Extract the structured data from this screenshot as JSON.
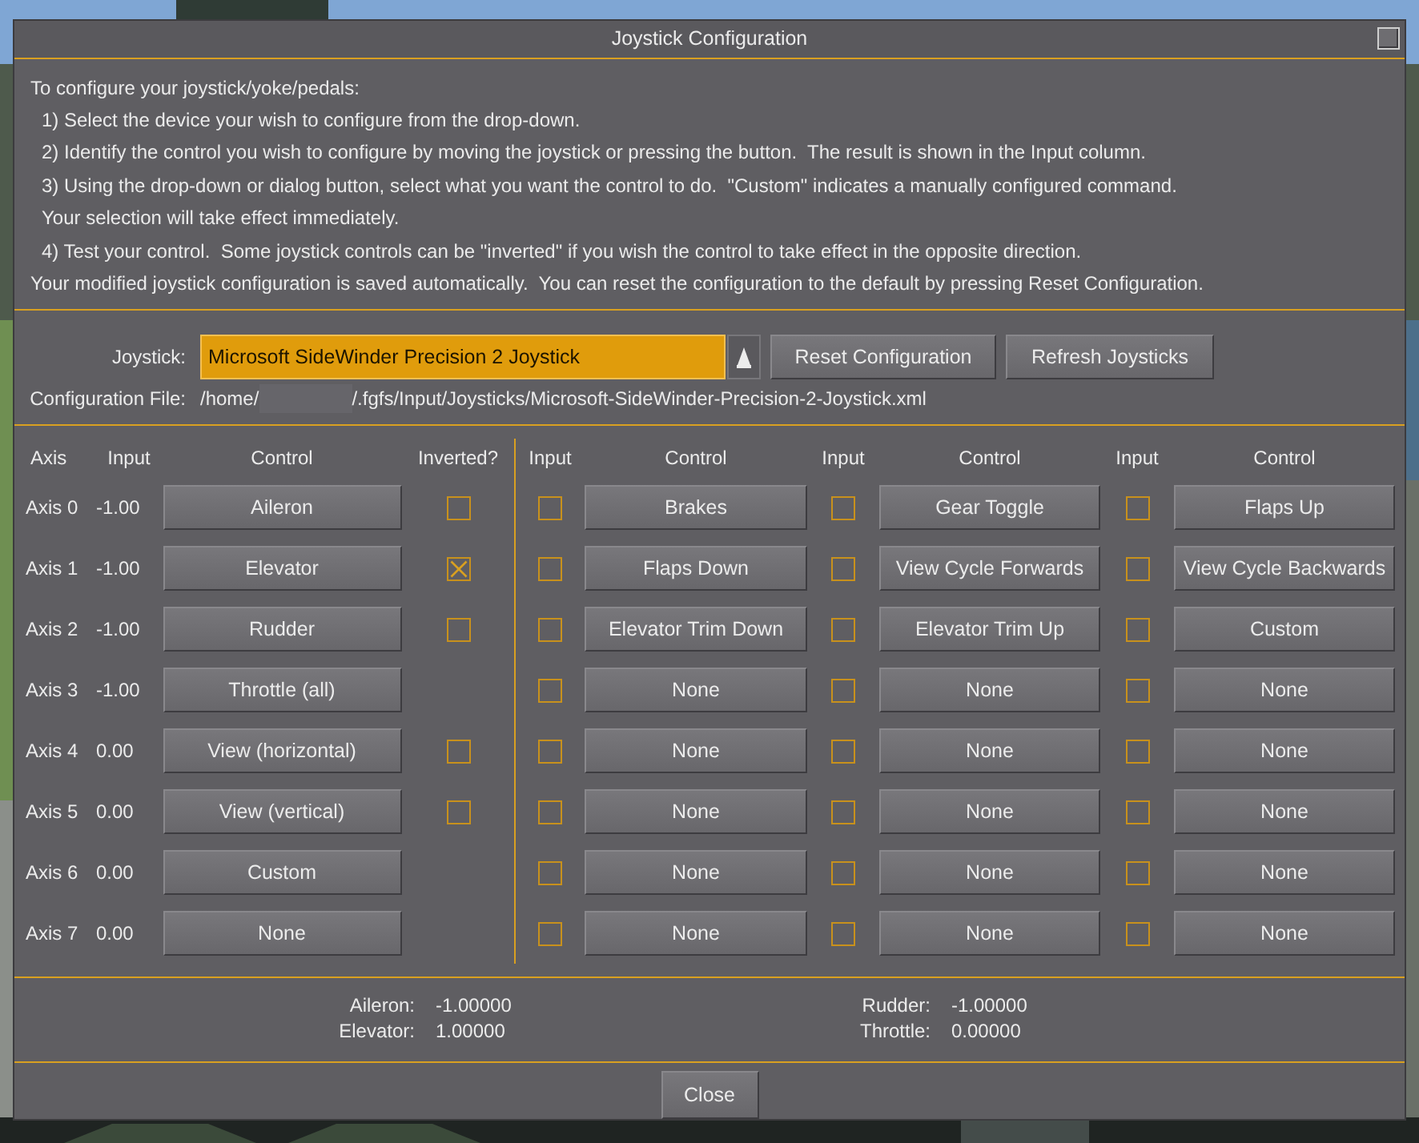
{
  "window": {
    "title": "Joystick Configuration"
  },
  "instructions": [
    {
      "text": "To configure your joystick/yoke/pedals:",
      "indented": false
    },
    {
      "text": "1) Select the device your wish to configure from the drop-down.",
      "indented": true
    },
    {
      "text": "2) Identify the control you wish to configure by moving the joystick or pressing the button.  The result is shown in the Input column.",
      "indented": true
    },
    {
      "text": "3) Using the drop-down or dialog button, select what you want the control to do.  \"Custom\" indicates a manually configured command.",
      "indented": true
    },
    {
      "text": "Your selection will take effect immediately.",
      "indented": true
    },
    {
      "text": "4) Test your control.  Some joystick controls can be \"inverted\" if you wish the control to take effect in the opposite direction.",
      "indented": true
    },
    {
      "text": "Your modified joystick configuration is saved automatically.  You can reset the configuration to the default by pressing Reset Configuration.",
      "indented": false
    }
  ],
  "joystick": {
    "label": "Joystick:",
    "value": "Microsoft SideWinder Precision 2 Joystick"
  },
  "actions": [
    "Reset Configuration",
    "Refresh Joysticks"
  ],
  "config_file": {
    "label": "Configuration File:",
    "path_start": "/home/",
    "path_end": "/.fgfs/Input/Joysticks/Microsoft-SideWinder-Precision-2-Joystick.xml"
  },
  "columns": {
    "axis": "Axis",
    "input": "Input",
    "control": "Control",
    "inverted": "Inverted?",
    "button_input": [
      "Input",
      "Input",
      "Input"
    ],
    "button_control": [
      "Control",
      "Control",
      "Control"
    ]
  },
  "rows": [
    {
      "axis": "Axis 0",
      "input": "-1.00",
      "control": "Aileron",
      "inverted": false,
      "buttons": [
        {
          "active": false,
          "control": "Brakes"
        },
        {
          "active": false,
          "control": "Gear Toggle"
        },
        {
          "active": false,
          "control": "Flaps Up"
        }
      ]
    },
    {
      "axis": "Axis 1",
      "input": "-1.00",
      "control": "Elevator",
      "inverted": true,
      "buttons": [
        {
          "active": false,
          "control": "Flaps Down"
        },
        {
          "active": false,
          "control": "View Cycle Forwards"
        },
        {
          "active": false,
          "control": "View Cycle Backwards"
        }
      ]
    },
    {
      "axis": "Axis 2",
      "input": "-1.00",
      "control": "Rudder",
      "inverted": false,
      "buttons": [
        {
          "active": false,
          "control": "Elevator Trim Down"
        },
        {
          "active": false,
          "control": "Elevator Trim Up"
        },
        {
          "active": false,
          "control": "Custom"
        }
      ]
    },
    {
      "axis": "Axis 3",
      "input": "-1.00",
      "control": "Throttle (all)",
      "buttons": [
        {
          "active": false,
          "control": "None"
        },
        {
          "active": false,
          "control": "None"
        },
        {
          "active": false,
          "control": "None"
        }
      ]
    },
    {
      "axis": "Axis 4",
      "input": "0.00",
      "control": "View (horizontal)",
      "inverted": false,
      "buttons": [
        {
          "active": false,
          "control": "None"
        },
        {
          "active": false,
          "control": "None"
        },
        {
          "active": false,
          "control": "None"
        }
      ]
    },
    {
      "axis": "Axis 5",
      "input": "0.00",
      "control": "View (vertical)",
      "inverted": false,
      "buttons": [
        {
          "active": false,
          "control": "None"
        },
        {
          "active": false,
          "control": "None"
        },
        {
          "active": false,
          "control": "None"
        }
      ]
    },
    {
      "axis": "Axis 6",
      "input": "0.00",
      "control": "Custom",
      "buttons": [
        {
          "active": false,
          "control": "None"
        },
        {
          "active": false,
          "control": "None"
        },
        {
          "active": false,
          "control": "None"
        }
      ]
    },
    {
      "axis": "Axis 7",
      "input": "0.00",
      "control": "None",
      "buttons": [
        {
          "active": false,
          "control": "None"
        },
        {
          "active": false,
          "control": "None"
        },
        {
          "active": false,
          "control": "None"
        }
      ]
    }
  ],
  "readouts": [
    {
      "label": "Aileron:",
      "value": "-1.00000"
    },
    {
      "label": "Rudder:",
      "value": "-1.00000"
    },
    {
      "label": "Elevator:",
      "value": "1.00000"
    },
    {
      "label": "Throttle:",
      "value": "0.00000"
    }
  ],
  "close_button": "Close"
}
